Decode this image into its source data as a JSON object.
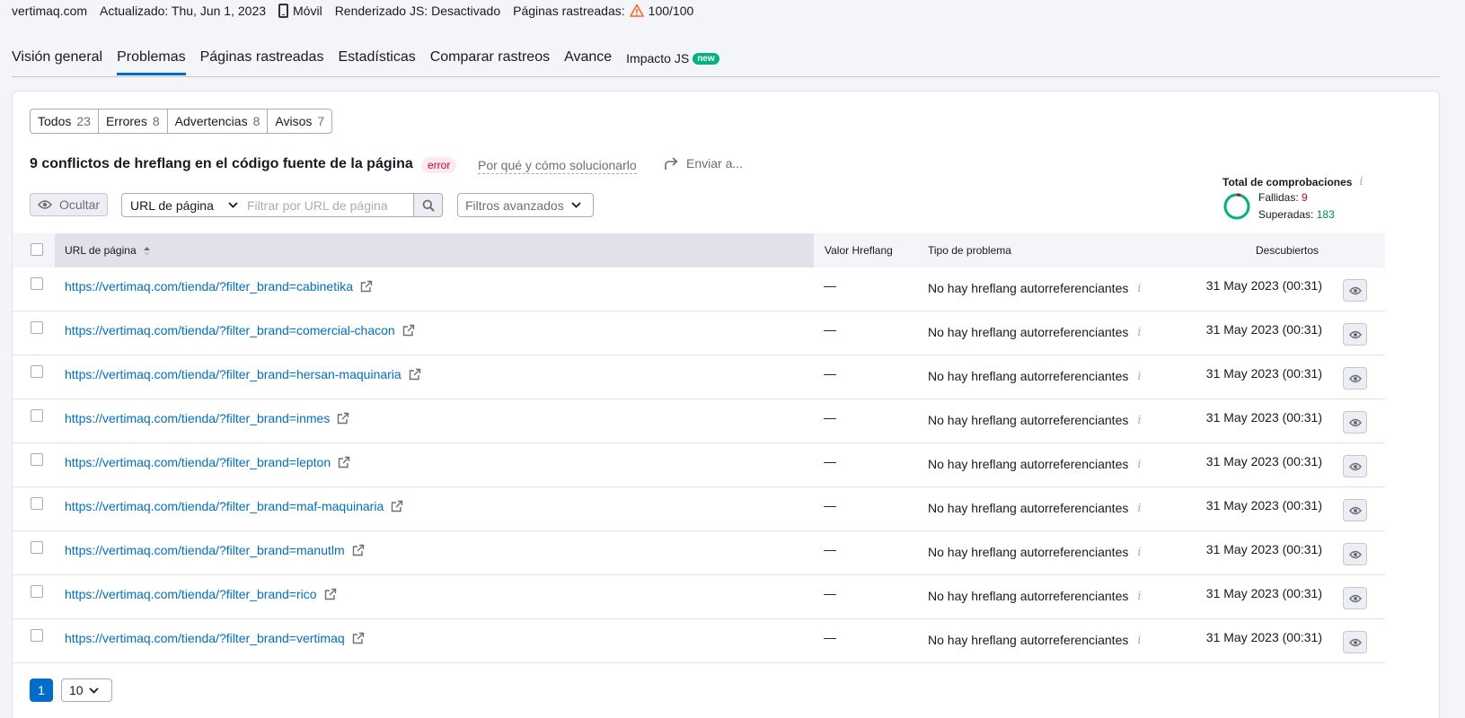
{
  "infobar": {
    "domain": "vertimaq.com",
    "updated": "Actualizado: Thu, Jun 1, 2023",
    "device": "Móvil",
    "js_render": "Renderizado JS: Desactivado",
    "crawled_label": "Páginas rastreadas:",
    "crawled_value": "100/100"
  },
  "tabs": [
    {
      "label": "Visión general"
    },
    {
      "label": "Problemas"
    },
    {
      "label": "Páginas rastreadas"
    },
    {
      "label": "Estadísticas"
    },
    {
      "label": "Comparar rastreos"
    },
    {
      "label": "Avance"
    },
    {
      "label": "Impacto JS",
      "badge": "new"
    }
  ],
  "segments": [
    {
      "label": "Todos",
      "count": "23"
    },
    {
      "label": "Errores",
      "count": "8"
    },
    {
      "label": "Advertencias",
      "count": "8"
    },
    {
      "label": "Avisos",
      "count": "7"
    }
  ],
  "issue": {
    "title": "9 conflictos de hreflang en el código fuente de la página",
    "tag": "error",
    "why_link": "Por qué y cómo solucionarlo",
    "send": "Enviar a..."
  },
  "checks": {
    "title": "Total de comprobaciones",
    "failed_label": "Fallidas:",
    "failed_value": "9",
    "passed_label": "Superadas:",
    "passed_value": "183"
  },
  "controls": {
    "hide": "Ocultar",
    "url_select": "URL de página",
    "filter_placeholder": "Filtrar por URL de página",
    "advanced": "Filtros avanzados"
  },
  "table": {
    "headers": {
      "url": "URL de página",
      "hreflang": "Valor Hreflang",
      "problem": "Tipo de problema",
      "found": "Descubiertos"
    },
    "rows": [
      {
        "url": "https://vertimaq.com/tienda/?filter_brand=cabinetika",
        "hreflang": "—",
        "problem": "No hay hreflang autorreferenciantes",
        "date": "31 May 2023 (00:31)"
      },
      {
        "url": "https://vertimaq.com/tienda/?filter_brand=comercial-chacon",
        "hreflang": "—",
        "problem": "No hay hreflang autorreferenciantes",
        "date": "31 May 2023 (00:31)"
      },
      {
        "url": "https://vertimaq.com/tienda/?filter_brand=hersan-maquinaria",
        "hreflang": "—",
        "problem": "No hay hreflang autorreferenciantes",
        "date": "31 May 2023 (00:31)"
      },
      {
        "url": "https://vertimaq.com/tienda/?filter_brand=inmes",
        "hreflang": "—",
        "problem": "No hay hreflang autorreferenciantes",
        "date": "31 May 2023 (00:31)"
      },
      {
        "url": "https://vertimaq.com/tienda/?filter_brand=lepton",
        "hreflang": "—",
        "problem": "No hay hreflang autorreferenciantes",
        "date": "31 May 2023 (00:31)"
      },
      {
        "url": "https://vertimaq.com/tienda/?filter_brand=maf-maquinaria",
        "hreflang": "—",
        "problem": "No hay hreflang autorreferenciantes",
        "date": "31 May 2023 (00:31)"
      },
      {
        "url": "https://vertimaq.com/tienda/?filter_brand=manutlm",
        "hreflang": "—",
        "problem": "No hay hreflang autorreferenciantes",
        "date": "31 May 2023 (00:31)"
      },
      {
        "url": "https://vertimaq.com/tienda/?filter_brand=rico",
        "hreflang": "—",
        "problem": "No hay hreflang autorreferenciantes",
        "date": "31 May 2023 (00:31)"
      },
      {
        "url": "https://vertimaq.com/tienda/?filter_brand=vertimaq",
        "hreflang": "—",
        "problem": "No hay hreflang autorreferenciantes",
        "date": "31 May 2023 (00:31)"
      }
    ]
  },
  "pagination": {
    "current_page": "1",
    "per_page": "10"
  },
  "colors": {
    "link": "#006dca",
    "error": "#d1002f",
    "success": "#008557",
    "new_badge": "#00b37e"
  },
  "icons": [
    "mobile-icon",
    "warning-icon",
    "share-arrow-icon",
    "info-icon",
    "eye-icon",
    "chevron-down-icon",
    "search-icon",
    "sort-icon",
    "external-link-icon"
  ]
}
